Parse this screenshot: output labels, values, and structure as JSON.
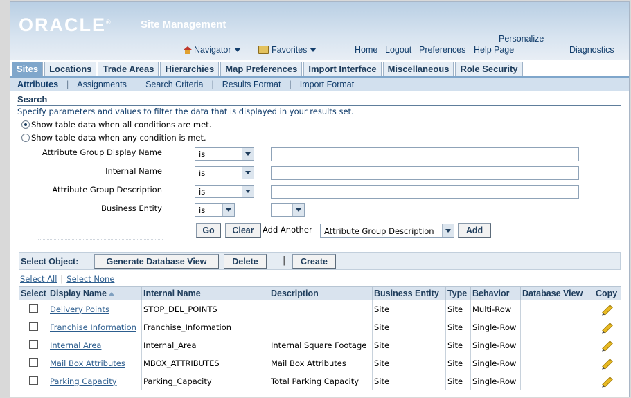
{
  "header": {
    "brand": "ORACLE",
    "brand_mark": "®",
    "app_title": "Site Management",
    "navigator_label": "Navigator",
    "favorites_label": "Favorites",
    "global_links": {
      "home": "Home",
      "logout": "Logout",
      "preferences": "Preferences",
      "help": "Help",
      "personalize_line1": "Personalize",
      "personalize_line2": "Page",
      "diagnostics": "Diagnostics"
    }
  },
  "tabs": [
    {
      "label": "Sites",
      "active": true
    },
    {
      "label": "Locations"
    },
    {
      "label": "Trade Areas"
    },
    {
      "label": "Hierarchies"
    },
    {
      "label": "Map Preferences"
    },
    {
      "label": "Import Interface"
    },
    {
      "label": "Miscellaneous"
    },
    {
      "label": "Role Security"
    }
  ],
  "subtabs": [
    {
      "label": "Attributes",
      "active": true
    },
    {
      "label": "Assignments"
    },
    {
      "label": "Search Criteria"
    },
    {
      "label": "Results Format"
    },
    {
      "label": "Import Format"
    }
  ],
  "search": {
    "title": "Search",
    "instructions": "Specify parameters and values to filter the data that is displayed in your results set.",
    "radio_all": "Show table data when all conditions are met.",
    "radio_any": "Show table data when any condition is met.",
    "fields": [
      {
        "label": "Attribute Group Display Name",
        "operator": "is",
        "value": ""
      },
      {
        "label": "Internal Name",
        "operator": "is",
        "value": ""
      },
      {
        "label": "Attribute Group Description",
        "operator": "is",
        "value": ""
      },
      {
        "label": "Business Entity",
        "operator": "is",
        "value": ""
      }
    ],
    "go_label": "Go",
    "clear_label": "Clear",
    "add_another_label": "Add Another",
    "add_another_value": "Attribute Group Description",
    "add_label": "Add"
  },
  "toolbar": {
    "select_object_label": "Select Object:",
    "generate_label": "Generate Database View",
    "delete_label": "Delete",
    "separator": "|",
    "create_label": "Create"
  },
  "selection": {
    "select_all": "Select All",
    "select_none": "Select None",
    "separator": "|"
  },
  "table": {
    "columns": [
      "Select",
      "Display Name",
      "Internal Name",
      "Description",
      "Business Entity",
      "Type",
      "Behavior",
      "Database View",
      "Copy"
    ],
    "rows": [
      {
        "display_name": "Delivery Points",
        "internal_name": "STOP_DEL_POINTS",
        "description": "",
        "business_entity": "Site",
        "type": "Site",
        "behavior": "Multi-Row",
        "database_view": ""
      },
      {
        "display_name": "Franchise Information",
        "internal_name": "Franchise_Information",
        "description": "",
        "business_entity": "Site",
        "type": "Site",
        "behavior": "Single-Row",
        "database_view": ""
      },
      {
        "display_name": "Internal Area",
        "internal_name": "Internal_Area",
        "description": "Internal Square Footage",
        "business_entity": "Site",
        "type": "Site",
        "behavior": "Single-Row",
        "database_view": ""
      },
      {
        "display_name": "Mail Box Attributes",
        "internal_name": "MBOX_ATTRIBUTES",
        "description": "Mail Box Attributes",
        "business_entity": "Site",
        "type": "Site",
        "behavior": "Single-Row",
        "database_view": ""
      },
      {
        "display_name": "Parking Capacity",
        "internal_name": "Parking_Capacity",
        "description": "Total Parking Capacity",
        "business_entity": "Site",
        "type": "Site",
        "behavior": "Single-Row",
        "database_view": ""
      }
    ]
  },
  "colors": {
    "active_tab": "#7fa6cb",
    "link": "#2c5d8e",
    "header_text": "#1f3d5c"
  }
}
